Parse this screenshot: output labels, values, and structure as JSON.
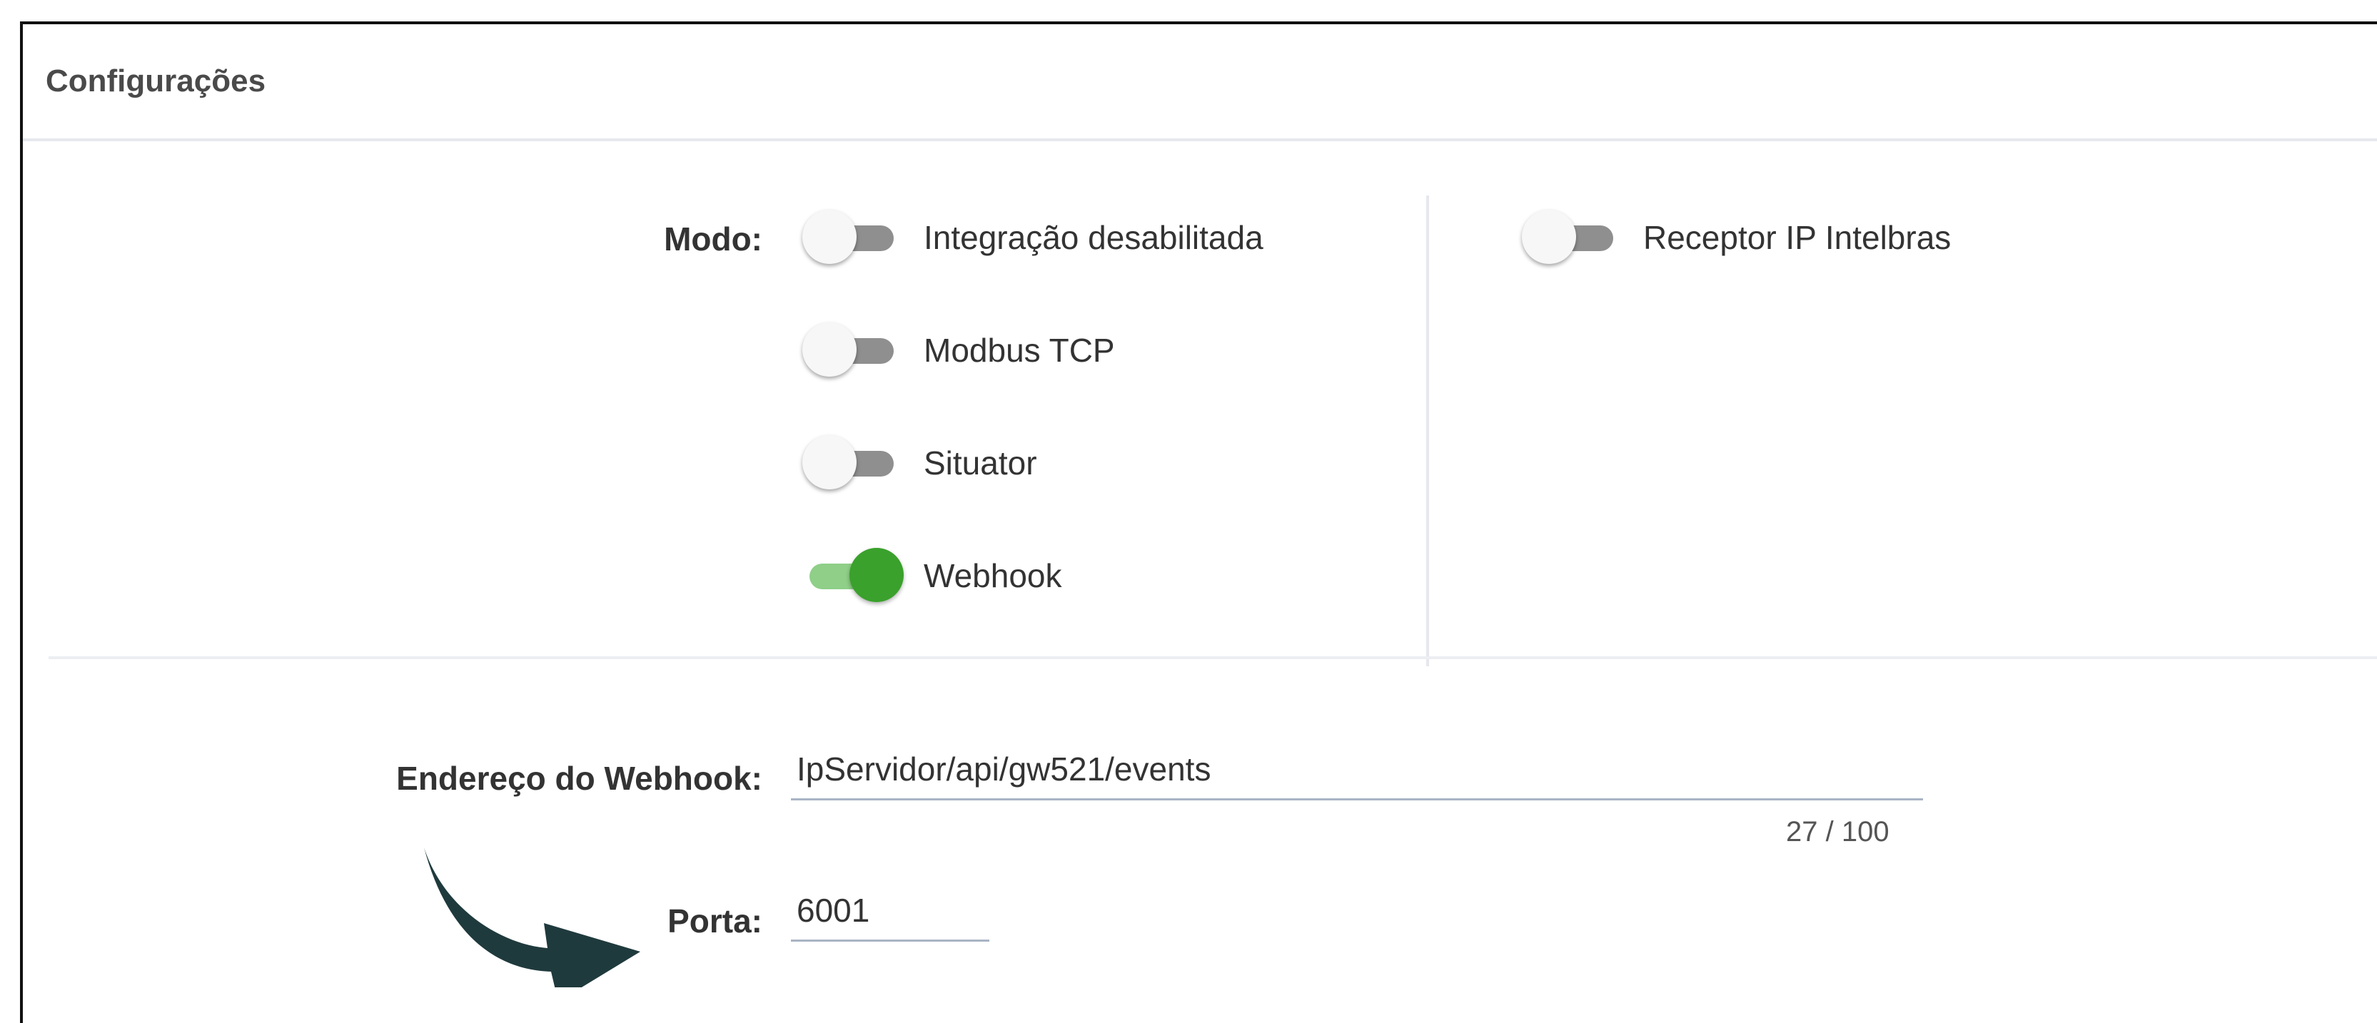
{
  "panel": {
    "title": "Configurações"
  },
  "modo": {
    "label": "Modo:",
    "options": [
      {
        "label": "Integração desabilitada",
        "enabled": false
      },
      {
        "label": "Modbus TCP",
        "enabled": false
      },
      {
        "label": "Situator",
        "enabled": false
      },
      {
        "label": "Webhook",
        "enabled": true
      },
      {
        "label": "Receptor IP Intelbras",
        "enabled": false
      }
    ]
  },
  "webhook": {
    "label": "Endereço do Webhook:",
    "value": "IpServidor/api/gw521/events",
    "counter": "27 / 100"
  },
  "porta": {
    "label": "Porta:",
    "value": "6001"
  },
  "colors": {
    "toggle_on_thumb": "#3aa12c",
    "toggle_on_track": "#8fcf88",
    "toggle_off_track": "#8f8f8f",
    "arrow": "#1f3a3d"
  },
  "annotation": {
    "icon": "curved-arrow-icon"
  }
}
